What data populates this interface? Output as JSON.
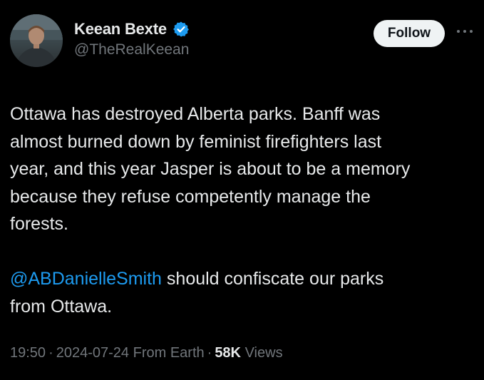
{
  "author": {
    "display_name": "Keean Bexte",
    "handle": "@TheRealKeean",
    "verified": true
  },
  "actions": {
    "follow_label": "Follow",
    "more_icon": "more-horizontal-icon"
  },
  "tweet": {
    "lines_paragraph_1": [
      "Ottawa has destroyed Alberta parks. Banff was",
      "almost burned down by feminist firefighters last",
      "year, and this year Jasper is about to be a memory",
      "because they refuse competently manage the",
      "forests."
    ],
    "mention": "@ABDanielleSmith",
    "paragraph_2_after_mention": " should confiscate our parks",
    "paragraph_2_line_2": "from Ottawa."
  },
  "meta": {
    "time": "19:50",
    "date": "2024-07-24",
    "source": "From Earth",
    "views_count": "58K",
    "views_label": "Views",
    "separator": "·"
  },
  "colors": {
    "background": "#000000",
    "text_primary": "#e7e9ea",
    "text_secondary": "#71767b",
    "link": "#1d9bf0",
    "follow_bg": "#eff3f4"
  }
}
